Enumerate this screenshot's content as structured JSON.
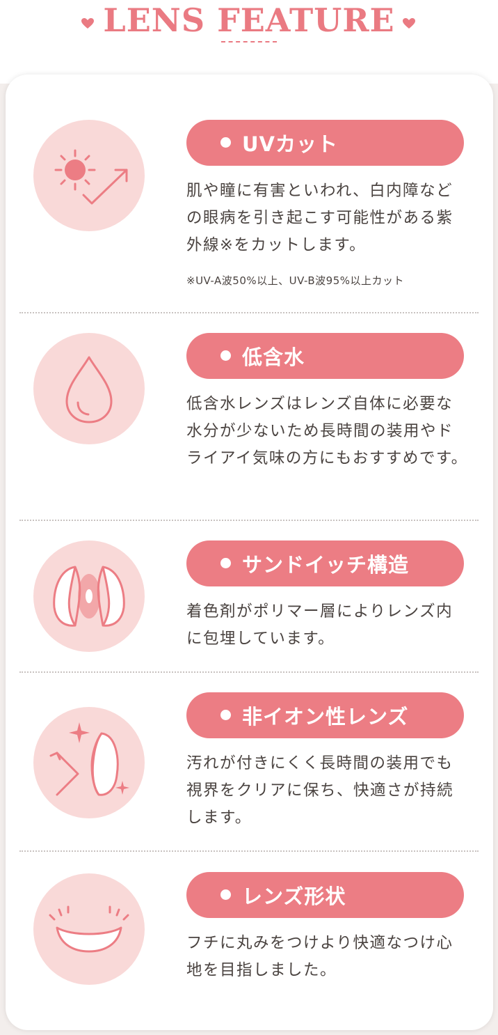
{
  "header": {
    "title": "LENS FEATURE"
  },
  "features": [
    {
      "title": "UVカット",
      "description": "肌や瞳に有害といわれ、白内障などの眼病を引き起こす可能性がある紫外線※をカットします。",
      "note": "※UV-A波50%以上、UV-B波95%以上カット",
      "icon": "uv-sun-icon"
    },
    {
      "title": "低含水",
      "description": "低含水レンズはレンズ自体に必要な水分が少ないため長時間の装用やドライアイ気味の方にもおすすめです。",
      "icon": "water-drop-icon"
    },
    {
      "title": "サンドイッチ構造",
      "description": "着色剤がポリマー層によりレンズ内に包埋しています。",
      "icon": "sandwich-lens-icon"
    },
    {
      "title": "非イオン性レンズ",
      "description": "汚れが付きにくく長時間の装用でも視界をクリアに保ち、快適さが持続します。",
      "icon": "sparkle-lens-icon"
    },
    {
      "title": "レンズ形状",
      "description": "フチに丸みをつけより快適なつけ心地を目指しました。",
      "icon": "lens-shape-icon"
    }
  ],
  "colors": {
    "accent": "#ec7d84",
    "circle": "#f9d9d8",
    "text": "#4a4340",
    "page": "#f3eeec"
  }
}
